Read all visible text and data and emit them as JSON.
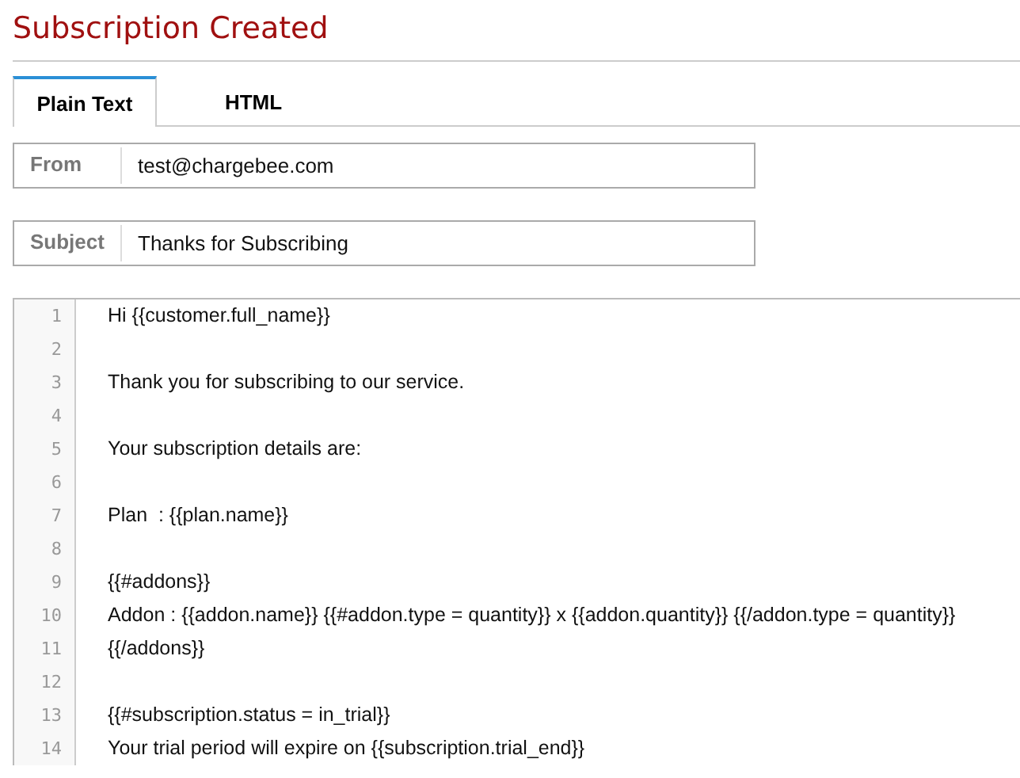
{
  "title": "Subscription Created",
  "tabs": [
    {
      "label": "Plain Text",
      "selected": true
    },
    {
      "label": "HTML",
      "selected": false
    }
  ],
  "fields": [
    {
      "label": "From",
      "value": "test@chargebee.com"
    },
    {
      "label": "Subject",
      "value": "Thanks for Subscribing"
    }
  ],
  "editor": {
    "lines": [
      {
        "number": "1",
        "text": "Hi {{customer.full_name}}"
      },
      {
        "number": "2"
      },
      {
        "number": "3",
        "text": "Thank you for subscribing to our service."
      },
      {
        "number": "4"
      },
      {
        "number": "5",
        "text": "Your subscription details are:"
      },
      {
        "number": "6"
      },
      {
        "number": "7",
        "text": "Plan  : {{plan.name}}"
      },
      {
        "number": "8"
      },
      {
        "number": "9",
        "text": "{{#addons}}"
      },
      {
        "number": "10",
        "text": "Addon : {{addon.name}} {{#addon.type = quantity}} x {{addon.quantity}} {{/addon.type = quantity}}"
      },
      {
        "number": "11",
        "text": "{{/addons}}"
      },
      {
        "number": "12"
      },
      {
        "number": "13",
        "text": "{{#subscription.status = in_trial}}"
      },
      {
        "number": "14",
        "text": "Your trial period will expire on {{subscription.trial_end}}"
      }
    ]
  }
}
